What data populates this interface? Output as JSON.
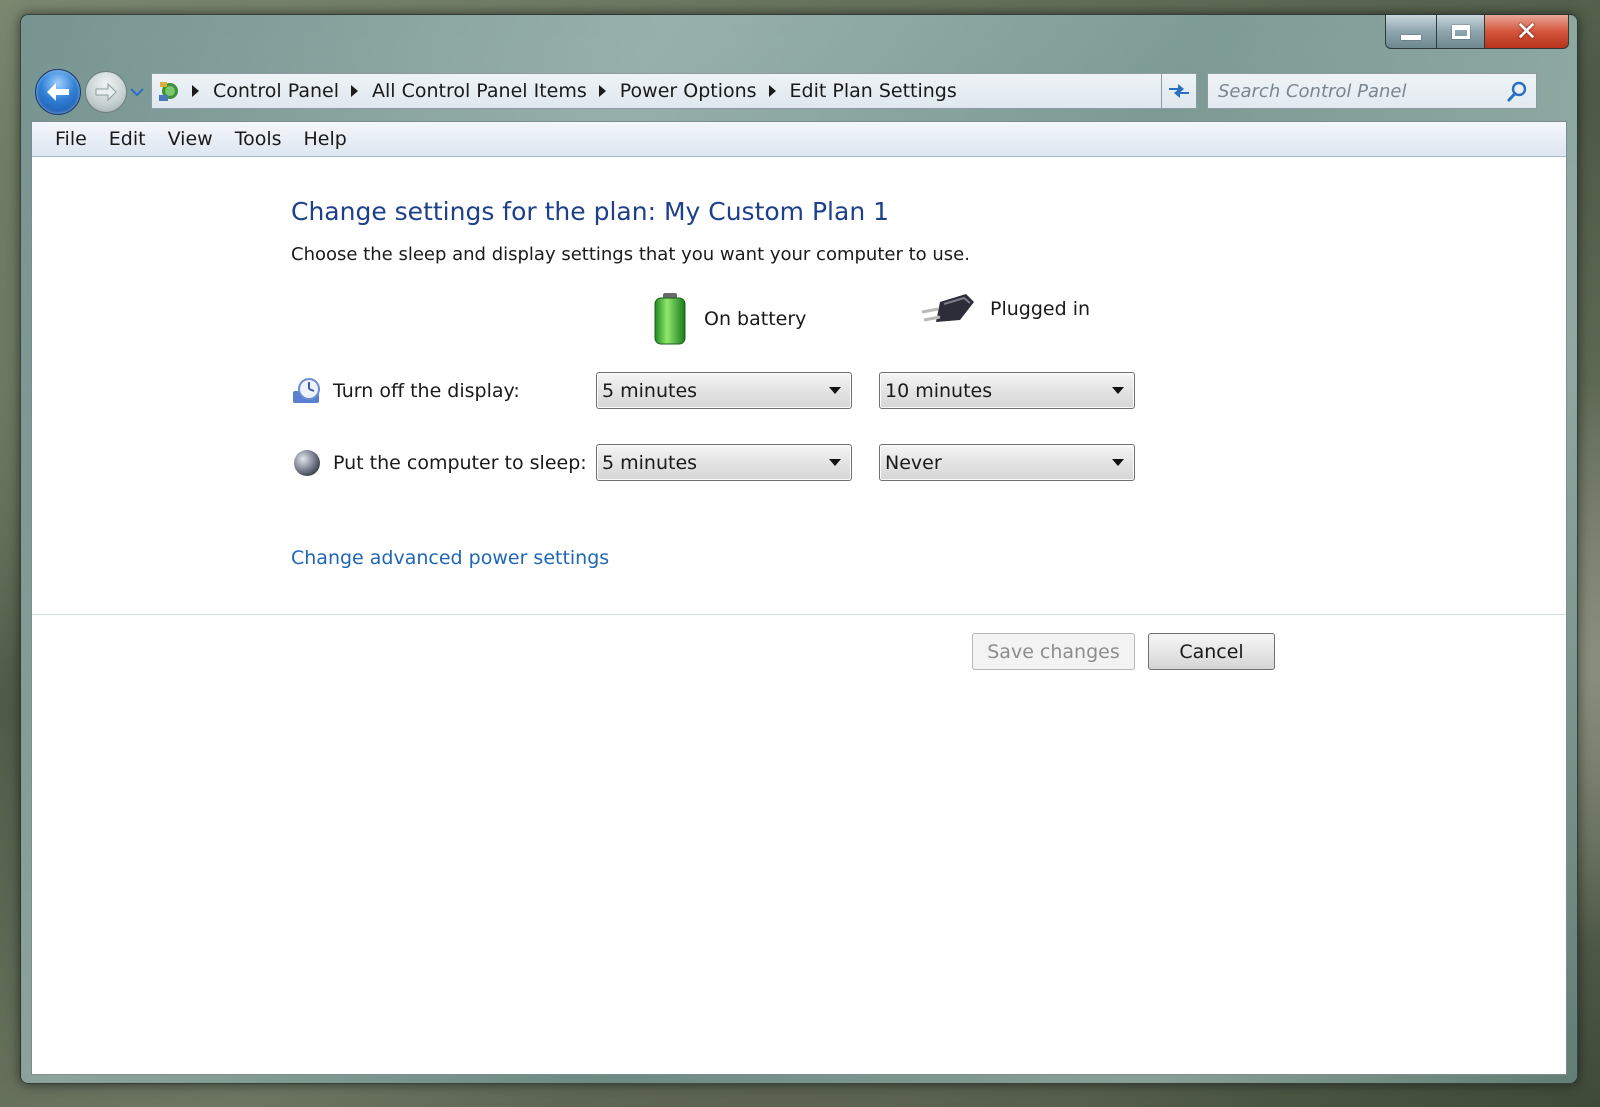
{
  "window": {
    "controls": {
      "minimize": "minimize-icon",
      "maximize": "maximize-icon",
      "close": "close-icon"
    }
  },
  "nav": {
    "back_icon": "back-arrow-icon",
    "forward_icon": "forward-arrow-icon",
    "breadcrumbs": [
      "Control Panel",
      "All Control Panel Items",
      "Power Options",
      "Edit Plan Settings"
    ],
    "search_placeholder": "Search Control Panel"
  },
  "menu": [
    "File",
    "Edit",
    "View",
    "Tools",
    "Help"
  ],
  "page": {
    "title": "Change settings for the plan: My Custom Plan 1",
    "subtitle": "Choose the sleep and display settings that you want your computer to use.",
    "columns": {
      "battery": "On battery",
      "plugged": "Plugged in"
    },
    "rows": {
      "display": {
        "label": "Turn off the display:",
        "battery": "5 minutes",
        "plugged": "10 minutes"
      },
      "sleep": {
        "label": "Put the computer to sleep:",
        "battery": "5 minutes",
        "plugged": "Never"
      }
    },
    "advanced_link": "Change advanced power settings",
    "save_label": "Save changes",
    "cancel_label": "Cancel"
  },
  "colors": {
    "title": "#1e3f8a",
    "link": "#1f66b5",
    "disabled_text": "#8d8d8d"
  }
}
